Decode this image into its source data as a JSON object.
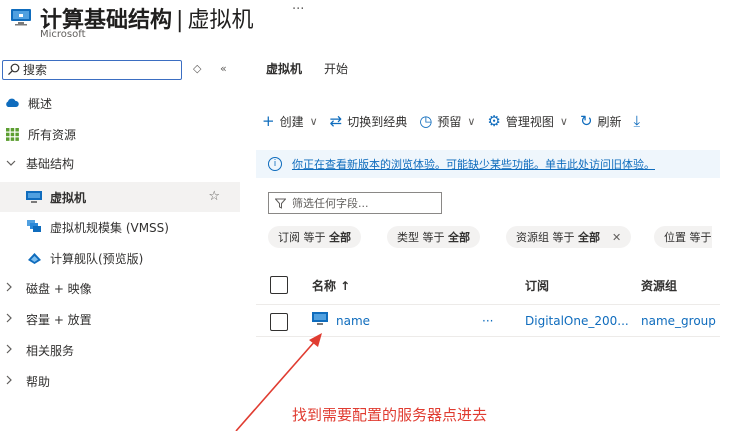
{
  "header": {
    "title_bold": "计算基础结构",
    "title_sep": "|",
    "title_rest": "虚拟机",
    "more": "···",
    "subtitle": "Microsoft"
  },
  "sidebar": {
    "search": {
      "value": "",
      "placeholder": "搜索"
    },
    "controls": {
      "toggle": "◇",
      "collapse": "«"
    },
    "items": [
      {
        "label": "概述",
        "icon": "cloud-icon"
      },
      {
        "label": "所有资源",
        "icon": "grid-icon"
      },
      {
        "label": "基础结构",
        "icon": "chevron-down-icon",
        "expanded": true
      },
      {
        "label": "虚拟机",
        "icon": "vm-icon",
        "selected": true,
        "favorite": "☆"
      },
      {
        "label": "虚拟机规模集 (VMSS)",
        "icon": "vmss-icon"
      },
      {
        "label": "计算舰队(预览版)",
        "icon": "fleet-icon"
      },
      {
        "label": "磁盘 + 映像",
        "icon": "chevron-right-icon"
      },
      {
        "label": "容量 + 放置",
        "icon": "chevron-right-icon"
      },
      {
        "label": "相关服务",
        "icon": "chevron-right-icon"
      },
      {
        "label": "帮助",
        "icon": "chevron-right-icon"
      }
    ]
  },
  "main": {
    "tabs": [
      {
        "label": "虚拟机",
        "active": true
      },
      {
        "label": "开始",
        "active": false
      }
    ],
    "toolbar": [
      {
        "label": "创建",
        "icon": "plus-icon",
        "dropdown": true
      },
      {
        "label": "切换到经典",
        "icon": "switch-icon",
        "dropdown": false
      },
      {
        "label": "预留",
        "icon": "clock-icon",
        "dropdown": true
      },
      {
        "label": "管理视图",
        "icon": "gear-icon",
        "dropdown": true
      },
      {
        "label": "刷新",
        "icon": "refresh-icon",
        "dropdown": false
      },
      {
        "label": "",
        "icon": "download-icon",
        "dropdown": false
      }
    ],
    "info": {
      "icon": "i",
      "text": "你正在查看新版本的浏览体验。可能缺少某些功能。单击此处访问旧体验。"
    },
    "filter": {
      "value": "",
      "placeholder": "筛选任何字段..."
    },
    "pills": [
      {
        "key": "订阅",
        "op": "等于",
        "value": "全部",
        "removable": false
      },
      {
        "key": "类型",
        "op": "等于",
        "value": "全部",
        "removable": false
      },
      {
        "key": "资源组",
        "op": "等于",
        "value": "全部",
        "removable": true
      },
      {
        "key": "位置",
        "op": "等于",
        "value": "",
        "removable": false
      }
    ],
    "table": {
      "columns": [
        "名称 ↑",
        "订阅",
        "资源组"
      ],
      "rows": [
        {
          "name": "name",
          "more": "···",
          "subscription": "DigitalOne_200...",
          "resource_group": "name_group"
        }
      ]
    }
  },
  "annotation": {
    "text": "找到需要配置的服务器点进去",
    "color": "#e03c31"
  },
  "colors": {
    "accent": "#0f6cbd",
    "selected_bg": "#f3f2f1",
    "info_bg": "#eff6fc"
  }
}
